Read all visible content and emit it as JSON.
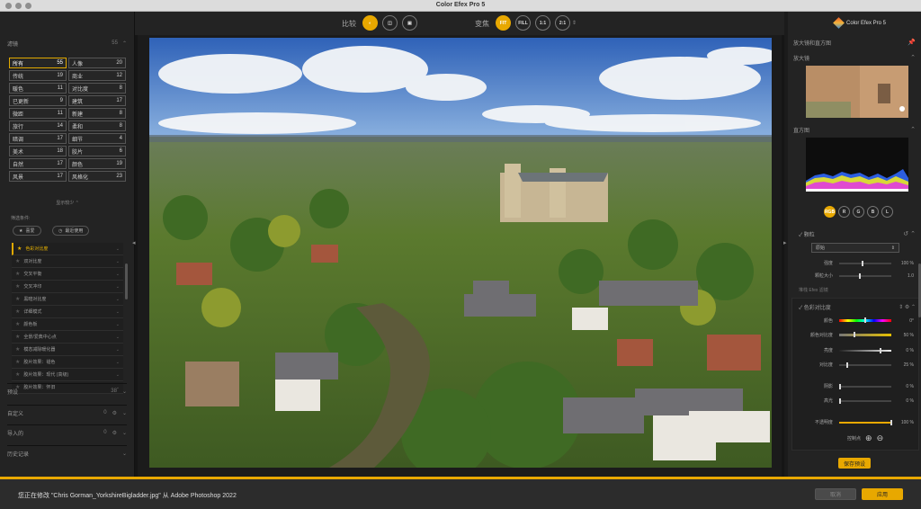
{
  "window": {
    "title": "Color Efex Pro 5"
  },
  "left_panel": {
    "filter_section": {
      "title": "滤镜",
      "count": "55"
    },
    "categories": [
      {
        "label": "所有",
        "count": "55",
        "selected": true
      },
      {
        "label": "人像",
        "count": "20"
      },
      {
        "label": "传统",
        "count": "19"
      },
      {
        "label": "商业",
        "count": "12"
      },
      {
        "label": "暖色",
        "count": "11"
      },
      {
        "label": "对比度",
        "count": "8"
      },
      {
        "label": "已更新",
        "count": "9"
      },
      {
        "label": "建筑",
        "count": "17"
      },
      {
        "label": "微距",
        "count": "11"
      },
      {
        "label": "新建",
        "count": "8"
      },
      {
        "label": "旅行",
        "count": "14"
      },
      {
        "label": "柔和",
        "count": "8"
      },
      {
        "label": "暗调",
        "count": "17"
      },
      {
        "label": "细节",
        "count": "4"
      },
      {
        "label": "美术",
        "count": "18"
      },
      {
        "label": "胶片",
        "count": "6"
      },
      {
        "label": "自然",
        "count": "17"
      },
      {
        "label": "颜色",
        "count": "19"
      },
      {
        "label": "风景",
        "count": "17"
      },
      {
        "label": "风格化",
        "count": "23"
      }
    ],
    "show_less": "显示较少",
    "filter_conditions_label": "筛选条件:",
    "chips": [
      {
        "label": "喜爱"
      },
      {
        "label": "最近使用"
      }
    ],
    "filter_list": [
      "色彩对比度",
      "双对比度",
      "交叉平衡",
      "交叉冲印",
      "黑暗对比度",
      "详细模式",
      "颜色板",
      "全景/爱典中心点",
      "模态减除暖化器",
      "胶片效果：褪色",
      "胶片效果：现代 (高级)",
      "胶片效果：怀旧"
    ],
    "sections": [
      {
        "title": "预设",
        "count": "38"
      },
      {
        "title": "自定义",
        "count": "0"
      },
      {
        "title": "导入的",
        "count": "0"
      },
      {
        "title": "历史记录",
        "count": ""
      }
    ]
  },
  "toolbar": {
    "compare_label": "比较",
    "zoom_label": "变焦",
    "zoom_buttons": [
      "FIT",
      "FILL",
      "1:1",
      "2:1"
    ]
  },
  "right_panel": {
    "logo": "Color Efex Pro 5",
    "magnifier_label": "放大镜和直方图",
    "loupe_label": "放大镜",
    "histogram_label": "直方图",
    "hist_buttons": [
      "RGB",
      "R",
      "G",
      "B",
      "L"
    ],
    "grain": {
      "title": "颗粒",
      "preset": "原始",
      "sliders": [
        {
          "label": "强度",
          "value": "100 %",
          "level": 0.45
        },
        {
          "label": "颗粒大小",
          "value": "1.0",
          "level": 0.4
        }
      ]
    },
    "stack_label": "堆栈 Efex 滤镜",
    "filter": {
      "title": "色彩对比度",
      "sliders": [
        {
          "label": "颜色",
          "value": "0°",
          "level": 0.5,
          "kind": "hue"
        },
        {
          "label": "颜色对比度",
          "value": "50 %",
          "level": 0.3,
          "kind": "color"
        },
        {
          "label": "亮度",
          "value": "0 %",
          "level": 0.8,
          "kind": "gray"
        },
        {
          "label": "对比度",
          "value": "25 %",
          "level": 0.15,
          "kind": "plain"
        },
        {
          "label": "阴影",
          "value": "0 %",
          "level": 0.02,
          "kind": "plain"
        },
        {
          "label": "高光",
          "value": "0 %",
          "level": 0.02,
          "kind": "plain"
        },
        {
          "label": "不透明度",
          "value": "100 %",
          "level": 1.0,
          "kind": "opacity"
        }
      ],
      "control_points_label": "控制点"
    },
    "save_preset": "保存预设"
  },
  "bottom_bar": {
    "message": "您正在修改 \"Chris Gorman_YorkshireBigladder.jpg\" 从 Adobe Photoshop 2022",
    "cancel": "取消",
    "apply": "应用"
  },
  "colors": {
    "accent": "#e8a800"
  }
}
